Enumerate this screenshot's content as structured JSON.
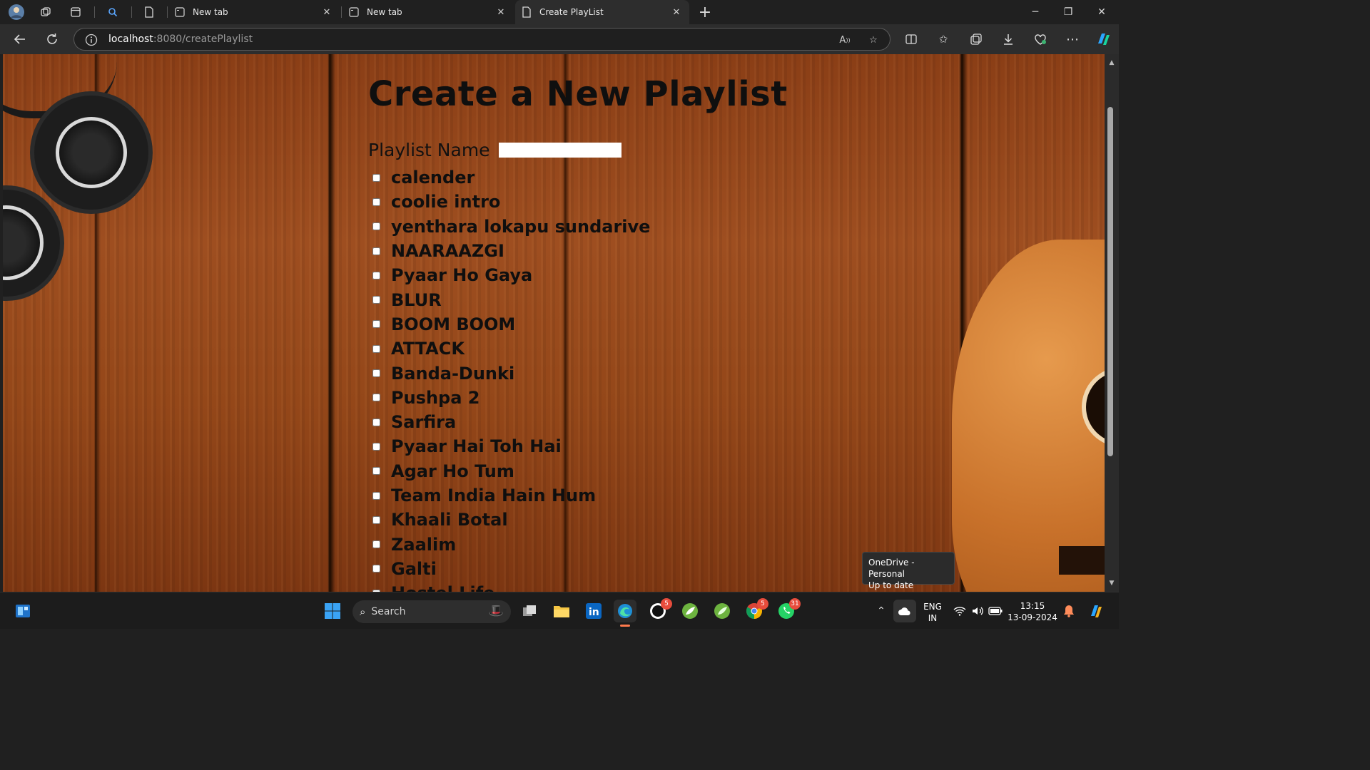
{
  "browser": {
    "tabs": [
      {
        "title": "New tab",
        "active": false
      },
      {
        "title": "New tab",
        "active": false
      },
      {
        "title": "Create PlayList",
        "active": true
      }
    ],
    "new_tab_symbol": "+",
    "address": {
      "host": "localhost",
      "path": ":8080/createPlaylist"
    }
  },
  "page": {
    "title": "Create a New Playlist",
    "name_label": "Playlist Name",
    "name_value": "",
    "songs": [
      "calender",
      "coolie intro",
      "yenthara lokapu sundarive",
      "NAARAAZGI",
      "Pyaar Ho Gaya",
      "BLUR",
      "BOOM BOOM",
      "ATTACK",
      "Banda-Dunki",
      "Pushpa 2",
      "Sarfira",
      "Pyaar Hai Toh Hai",
      "Agar Ho Tum",
      "Team India Hain Hum",
      "Khaali Botal",
      "Zaalim",
      "Galti",
      "Hostel Life"
    ]
  },
  "tooltip": {
    "line1": "OneDrive - Personal",
    "line2": "Up to date"
  },
  "taskbar": {
    "search_label": "Search",
    "badges": {
      "github": "5",
      "chrome": "5",
      "whatsapp": "31"
    },
    "language": {
      "line1": "ENG",
      "line2": "IN"
    },
    "clock": {
      "time": "13:15",
      "date": "13-09-2024"
    }
  },
  "colors": {
    "page_bg": "#944719",
    "title_text": "#0f0f0f",
    "taskbar_bg": "#1c1c1c",
    "browser_chrome": "#202020"
  }
}
